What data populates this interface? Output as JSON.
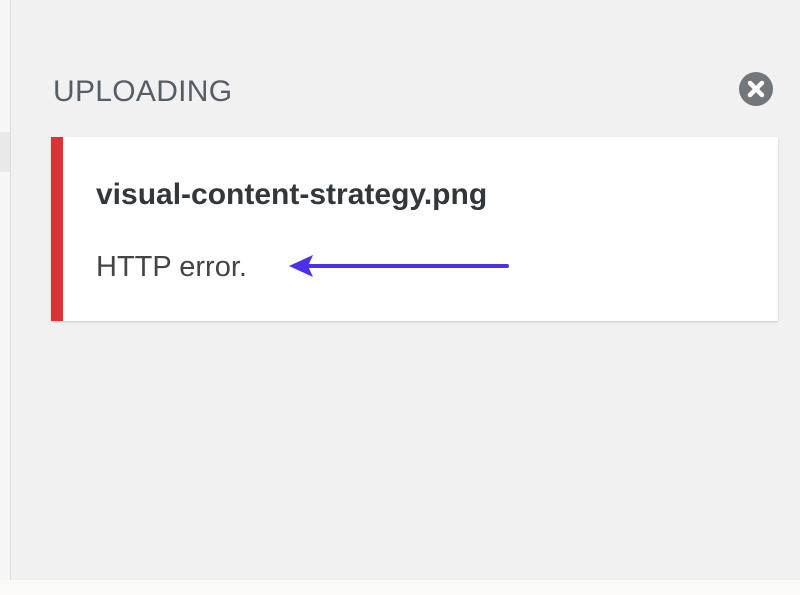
{
  "uploader": {
    "title": "UPLOADING",
    "close_icon": "close-circle-icon"
  },
  "upload_item": {
    "filename": "visual-content-strategy.png",
    "error_message": "HTTP error.",
    "status_color": "#dc3232"
  },
  "annotation": {
    "arrow_icon": "left-arrow-icon",
    "arrow_color": "#4b32e6"
  }
}
